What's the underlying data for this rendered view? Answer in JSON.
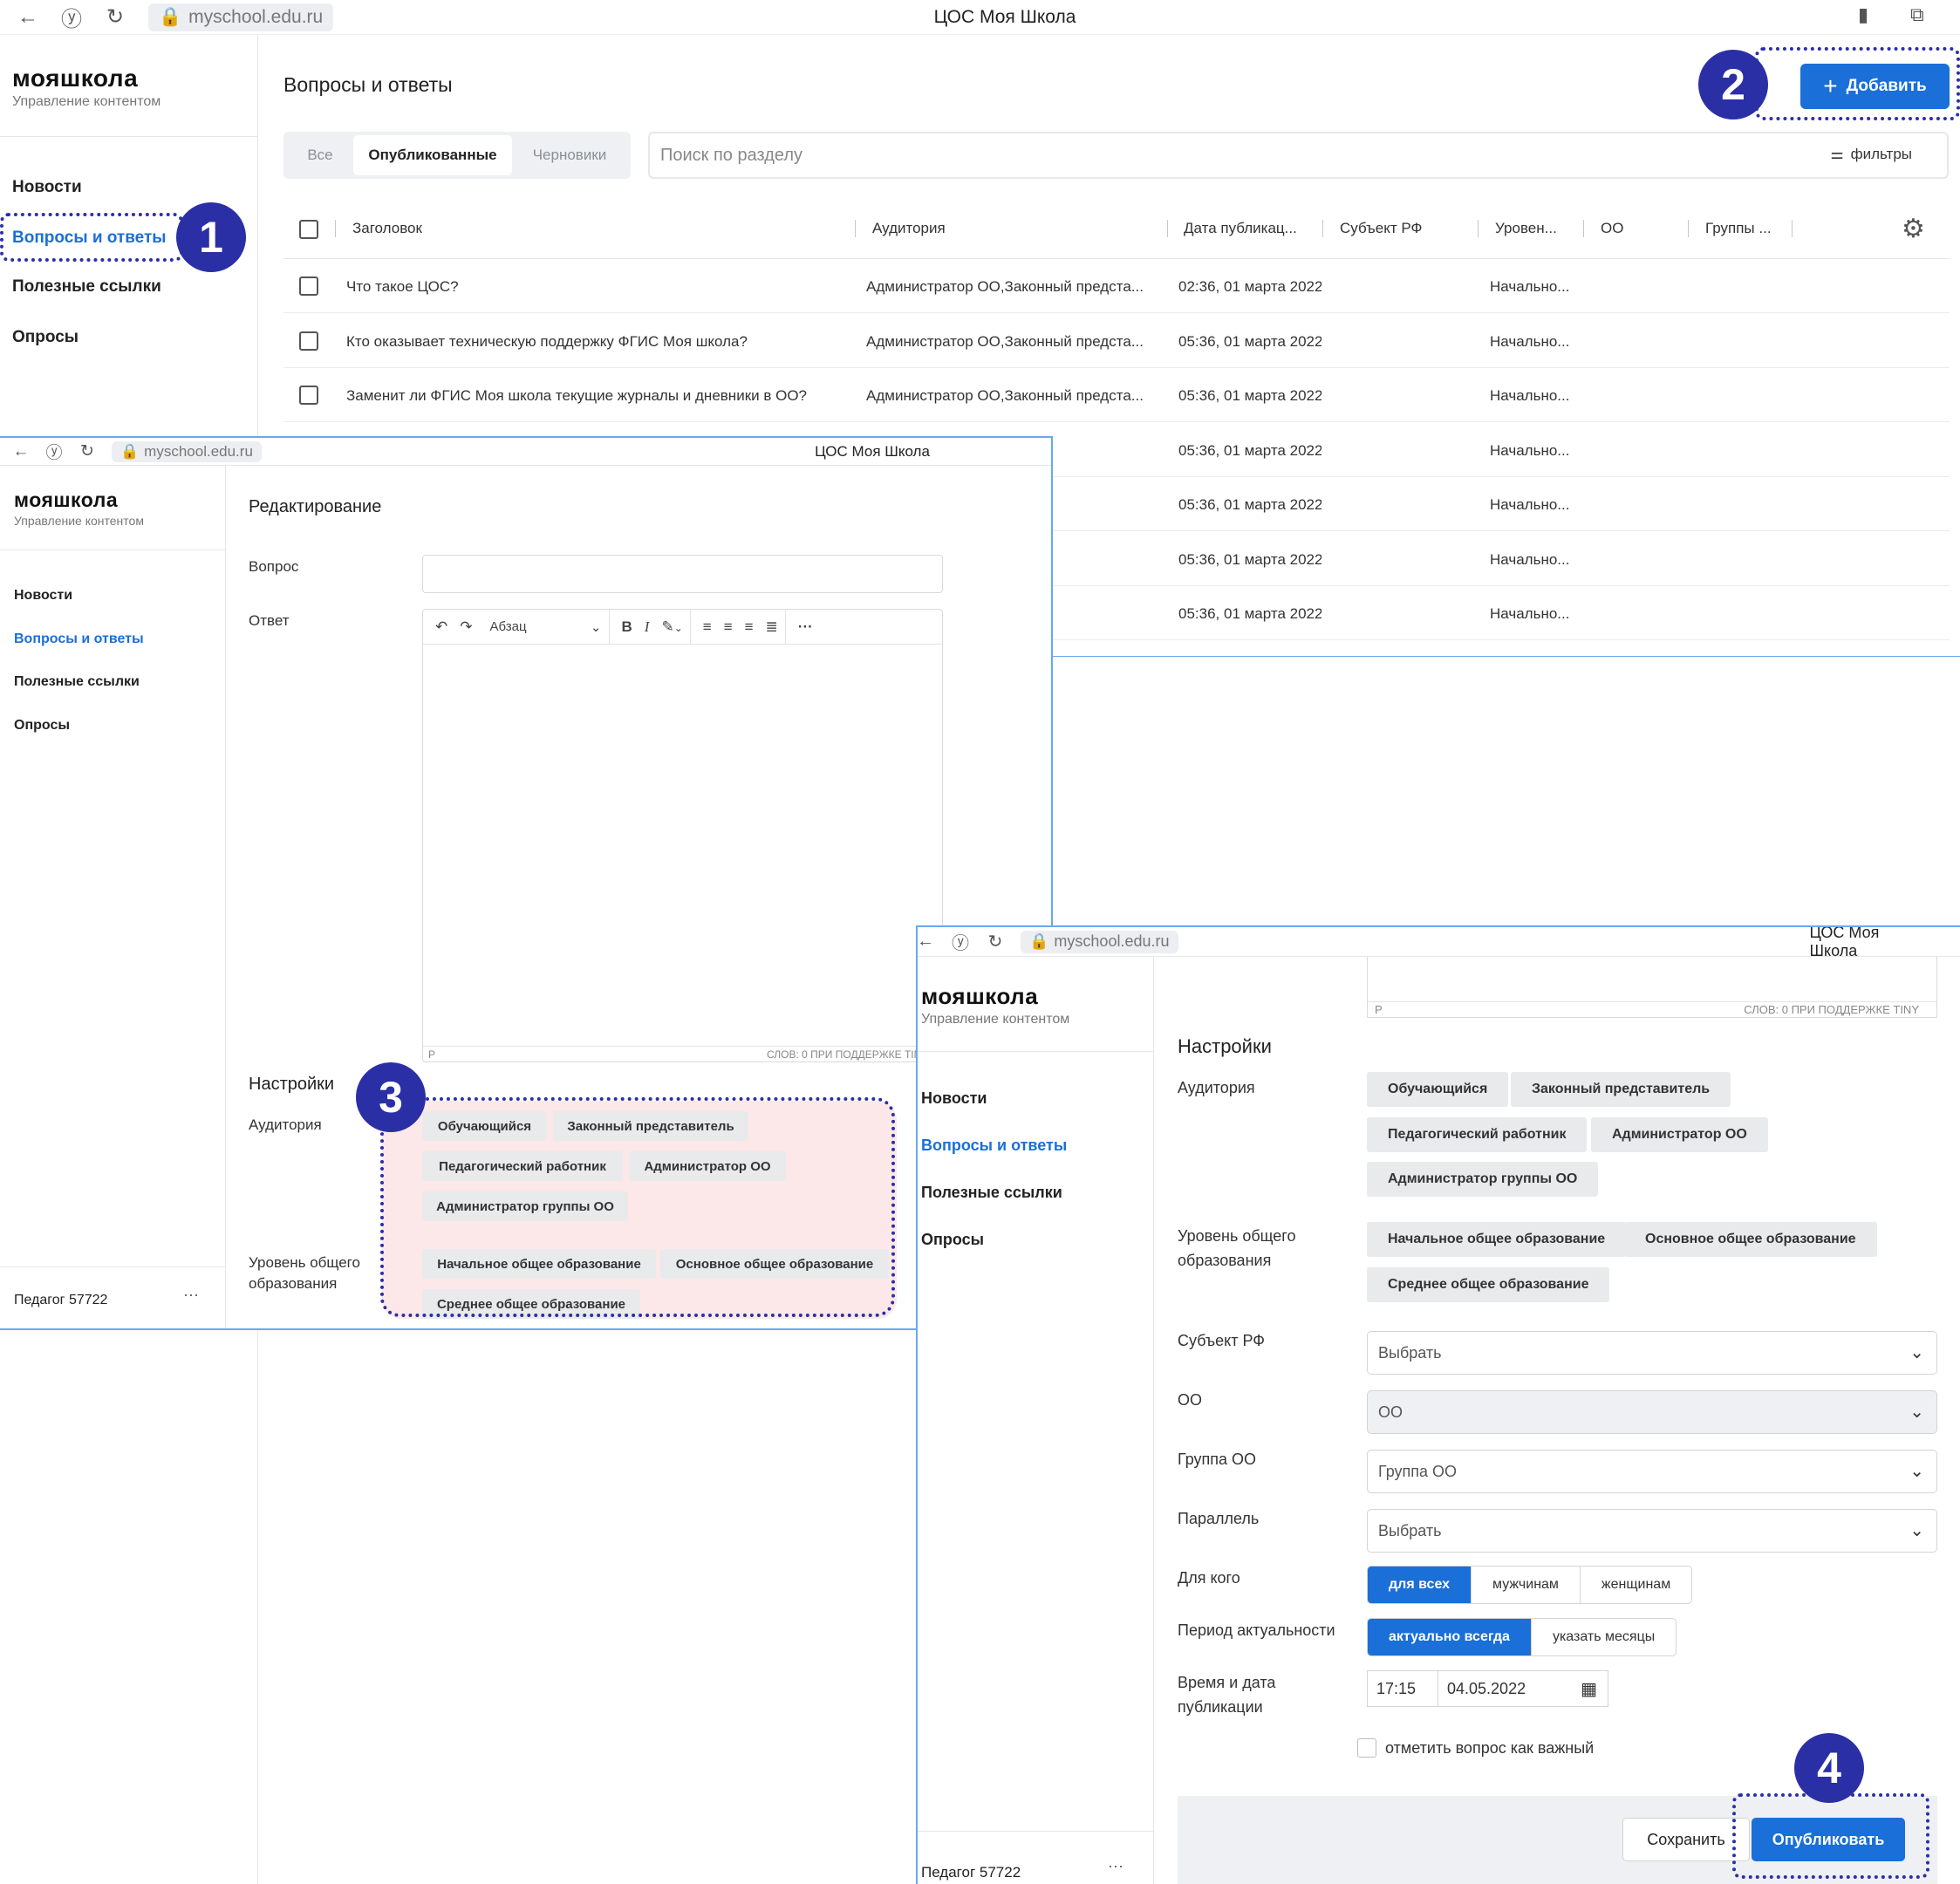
{
  "colors": {
    "accent": "#1a6fd8",
    "annotation": "#2b2fa6",
    "highlight": "#fce8e8"
  },
  "browser": {
    "url": "myschool.edu.ru",
    "title": "ЦОС Моя Школа"
  },
  "app": {
    "logo": "мояшкола",
    "subtitle": "Управление контентом"
  },
  "sidebar": {
    "items": [
      "Новости",
      "Вопросы и ответы",
      "Полезные ссылки",
      "Опросы"
    ],
    "active_index": 1
  },
  "list_page": {
    "title": "Вопросы и ответы",
    "add_button": "Добавить",
    "tabs": [
      "Все",
      "Опубликованные",
      "Черновики"
    ],
    "active_tab": 1,
    "search_placeholder": "Поиск по разделу",
    "filters_label": "фильтры",
    "columns": [
      "Заголовок",
      "Аудитория",
      "Дата публикац...",
      "Субъект РФ",
      "Уровен...",
      "ОО",
      "Группы ..."
    ],
    "rows": [
      {
        "title": "Что такое ЦОС?",
        "audience": "Администратор ОО,Законный предста...",
        "date": "02:36, 01 марта 2022",
        "level": "Начально..."
      },
      {
        "title": "Кто оказывает техническую поддержку ФГИС Моя школа?",
        "audience": "Администратор ОО,Законный предста...",
        "date": "05:36, 01 марта 2022",
        "level": "Начально..."
      },
      {
        "title": "Заменит ли ФГИС Моя школа текущие журналы и дневники в ОО?",
        "audience": "Администратор ОО,Законный предста...",
        "date": "05:36, 01 марта 2022",
        "level": "Начально..."
      },
      {
        "title": "",
        "audience": "ный предста...",
        "date": "05:36, 01 марта 2022",
        "level": "Начально..."
      },
      {
        "title": "",
        "audience": "ный предста...",
        "date": "05:36, 01 марта 2022",
        "level": "Начально..."
      },
      {
        "title": "",
        "audience": "ный предста...",
        "date": "05:36, 01 марта 2022",
        "level": "Начально..."
      },
      {
        "title": "",
        "audience": "ный предста...",
        "date": "05:36, 01 марта 2022",
        "level": "Начально..."
      }
    ]
  },
  "edit_page": {
    "title": "Редактирование",
    "question_label": "Вопрос",
    "answer_label": "Ответ",
    "format_select": "Абзац",
    "editor_path": "P",
    "editor_status": "СЛОВ: 0  ПРИ ПОДДЕРЖКЕ TINY",
    "settings_title": "Настройки",
    "audience_label": "Аудитория",
    "audience_chips": [
      "Обучающийся",
      "Законный представитель",
      "Педагогический работник",
      "Администратор ОО",
      "Администратор группы ОО"
    ],
    "level_label_1": "Уровень общего",
    "level_label_2": "образования",
    "level_chips": [
      "Начальное общее образование",
      "Основное общее образование",
      "Среднее общее образование"
    ],
    "user": "Педагог 57722",
    "user_menu": "···"
  },
  "publish_page": {
    "subject_label": "Субъект РФ",
    "subject_value": "Выбрать",
    "oo_label": "ОО",
    "oo_value": "ОО",
    "group_label": "Группа ОО",
    "group_value": "Группа ОО",
    "parallel_label": "Параллель",
    "parallel_value": "Выбрать",
    "for_whom_label": "Для кого",
    "for_whom_options": [
      "для всех",
      "мужчинам",
      "женщинам"
    ],
    "period_label": "Период актуальности",
    "period_options": [
      "актуально всегда",
      "указать месяцы"
    ],
    "datetime_label_1": "Время и дата",
    "datetime_label_2": "публикации",
    "time_value": "17:15",
    "date_value": "04.05.2022",
    "important_label": "отметить вопрос как важный",
    "save_button": "Сохранить",
    "publish_button": "Опубликовать"
  },
  "annotations": [
    "1",
    "2",
    "3",
    "4"
  ]
}
